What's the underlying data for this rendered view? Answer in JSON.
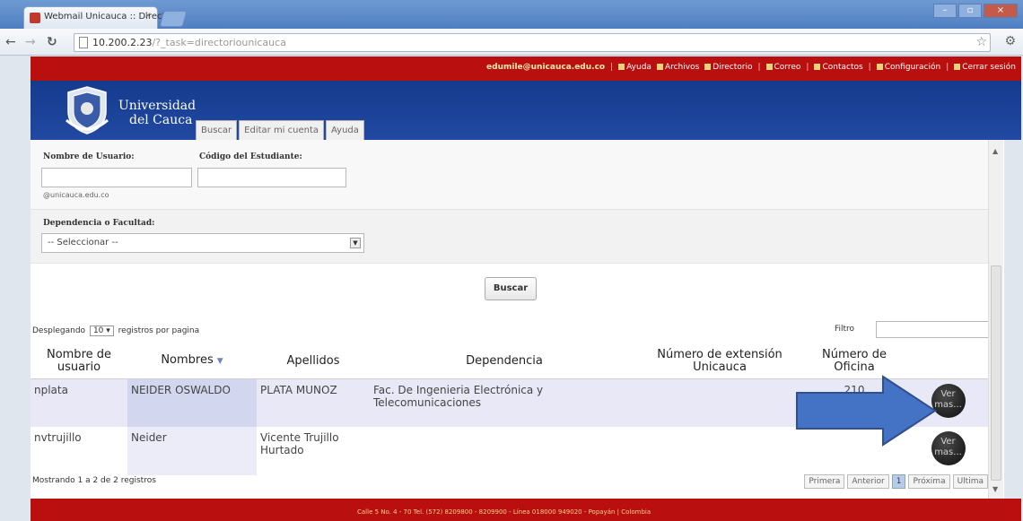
{
  "browser": {
    "tab_title": "Webmail Unicauca :: Directo",
    "url_host": "10.200.2.23",
    "url_path": "/?_task=directoriounicauca"
  },
  "header": {
    "email": "edumile@unicauca.edu.co",
    "links": [
      "Ayuda",
      "Archivos",
      "Directorio",
      "Correo",
      "Contactos",
      "Configuración",
      "Cerrar sesión"
    ],
    "university_line1": "Universidad",
    "university_line2": "del Cauca",
    "menu": [
      "Buscar",
      "Editar mi cuenta",
      "Ayuda"
    ]
  },
  "form": {
    "username_label": "Nombre de Usuario:",
    "student_code_label": "Código del Estudiante:",
    "domain_hint": "@unicauca.edu.co",
    "dependency_label": "Dependencia o Facultad:",
    "dependency_selected": "-- Seleccionar --",
    "search_button": "Buscar"
  },
  "table": {
    "length_prefix": "Desplegando",
    "length_value": "10",
    "length_suffix": "registros por pagina",
    "filter_label": "Filtro",
    "headers": [
      "Nombre de usuario",
      "Nombres",
      "Apellidos",
      "Dependencia",
      "Número de extensión Unicauca",
      "Número de Oficina"
    ],
    "rows": [
      {
        "usuario": "nplata",
        "nombres": "NEIDER OSWALDO",
        "apellidos": "PLATA MUNOZ",
        "dependencia": "Fac. De Ingenieria Electrónica y Telecomunicaciones",
        "extension": "",
        "oficina": "210",
        "action": "Ver mas..."
      },
      {
        "usuario": "nvtrujillo",
        "nombres": "Neider",
        "apellidos": "Vicente Trujillo Hurtado",
        "dependencia": "",
        "extension": "",
        "oficina": "",
        "action": "Ver mas..."
      }
    ],
    "info": "Mostrando 1 a 2 de 2 registros",
    "pager": [
      "Primera",
      "Anterior",
      "1",
      "Próxima",
      "Ultima"
    ]
  },
  "footer": {
    "address": "Calle 5 No. 4 - 70 Tel. (572) 8209800 - 8209900 - Línea 018000 949020 - Popayán | Colombia"
  },
  "colors": {
    "red_bar": "#b90f0f",
    "blue_header": "#1a3f92",
    "annotation_arrow": "#3f6fb6"
  }
}
